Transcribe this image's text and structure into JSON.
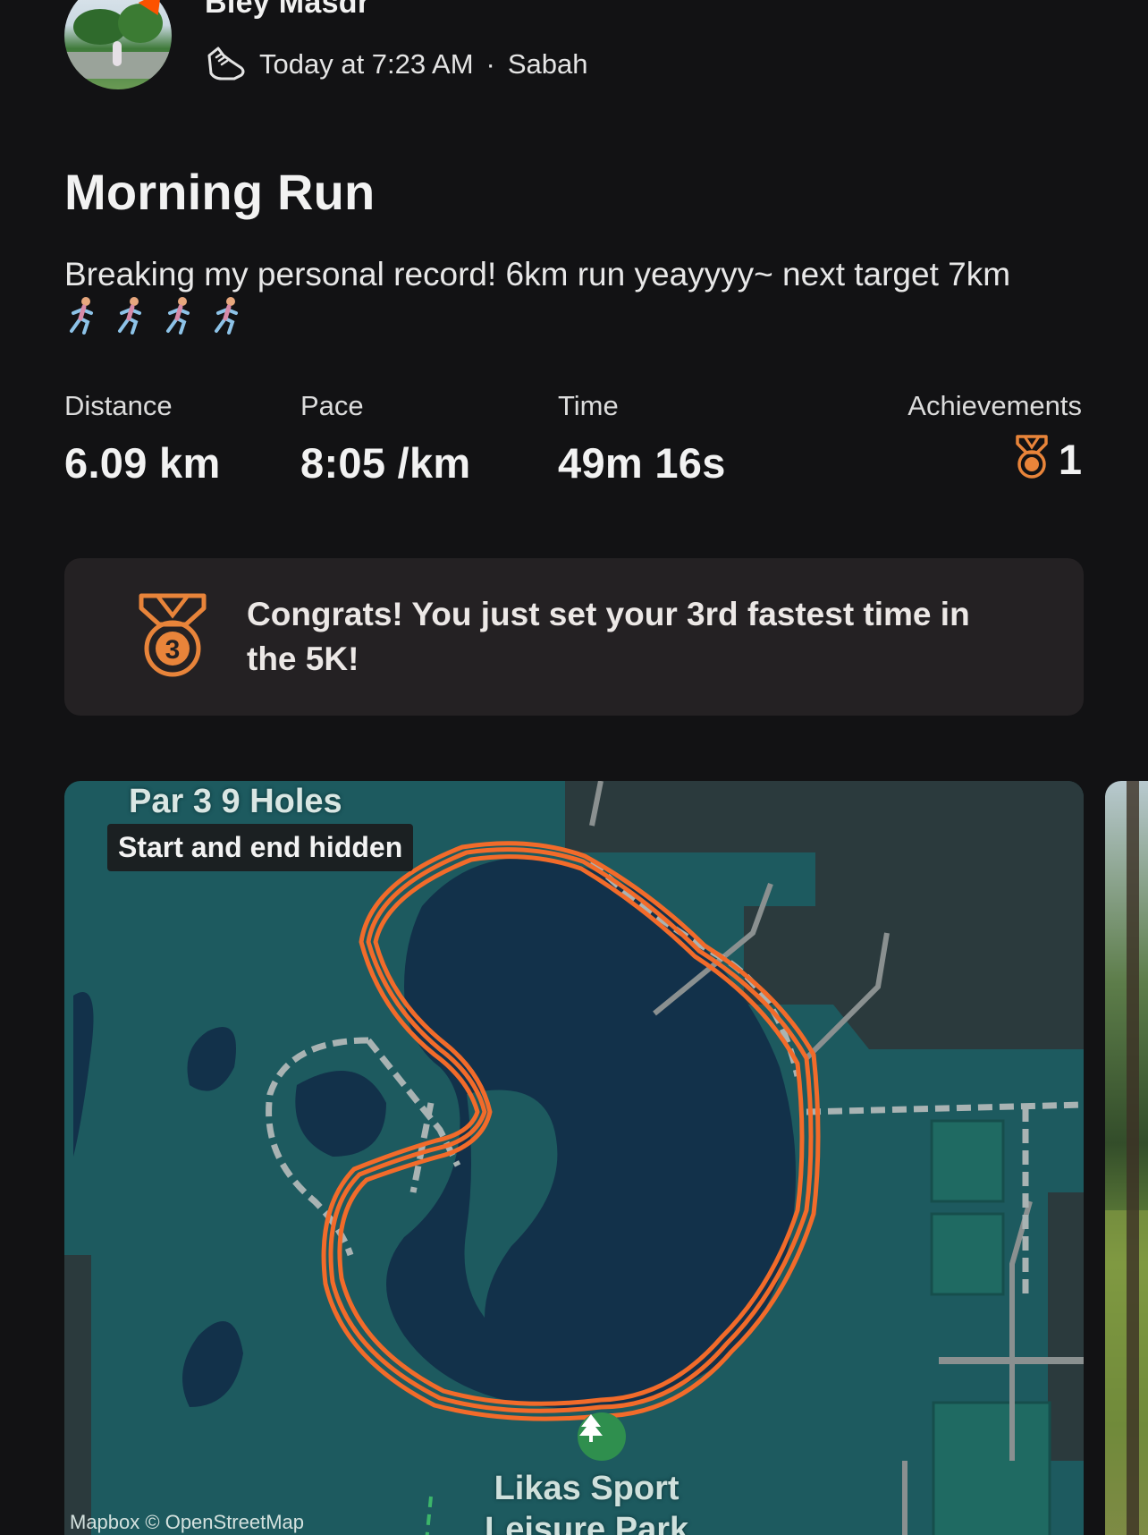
{
  "header": {
    "user_name": "Biey Masdr",
    "timestamp": "Today at 7:23 AM",
    "separator": "·",
    "location": "Sabah",
    "activity_icon": "running-shoe-icon",
    "brand_color": "#fc5200"
  },
  "activity": {
    "title": "Morning Run",
    "description": "Breaking my personal record! 6km run yeayyyy~  next target 7km",
    "emojis": [
      "runner",
      "runner",
      "runner",
      "runner"
    ]
  },
  "stats": {
    "distance": {
      "label": "Distance",
      "value": "6.09 km"
    },
    "pace": {
      "label": "Pace",
      "value": "8:05 /km"
    },
    "time": {
      "label": "Time",
      "value": "49m 16s"
    },
    "achievements": {
      "label": "Achievements",
      "value": "1",
      "icon": "medal-icon"
    }
  },
  "congrats_card": {
    "message": "Congrats! You just set your 3rd fastest time in the 5K!",
    "medal_rank": "3",
    "medal_color": "#e8843a"
  },
  "map": {
    "place_label": "Par 3 9 Holes",
    "privacy_badge": "Start and end hidden",
    "park_label_line1": "Likas Sport",
    "park_label_line2": "Leisure Park",
    "attribution": "Mapbox © OpenStreetMap",
    "route_color": "#f26b2a",
    "water_color": "#12314a",
    "land_color": "#1d5a5f"
  }
}
